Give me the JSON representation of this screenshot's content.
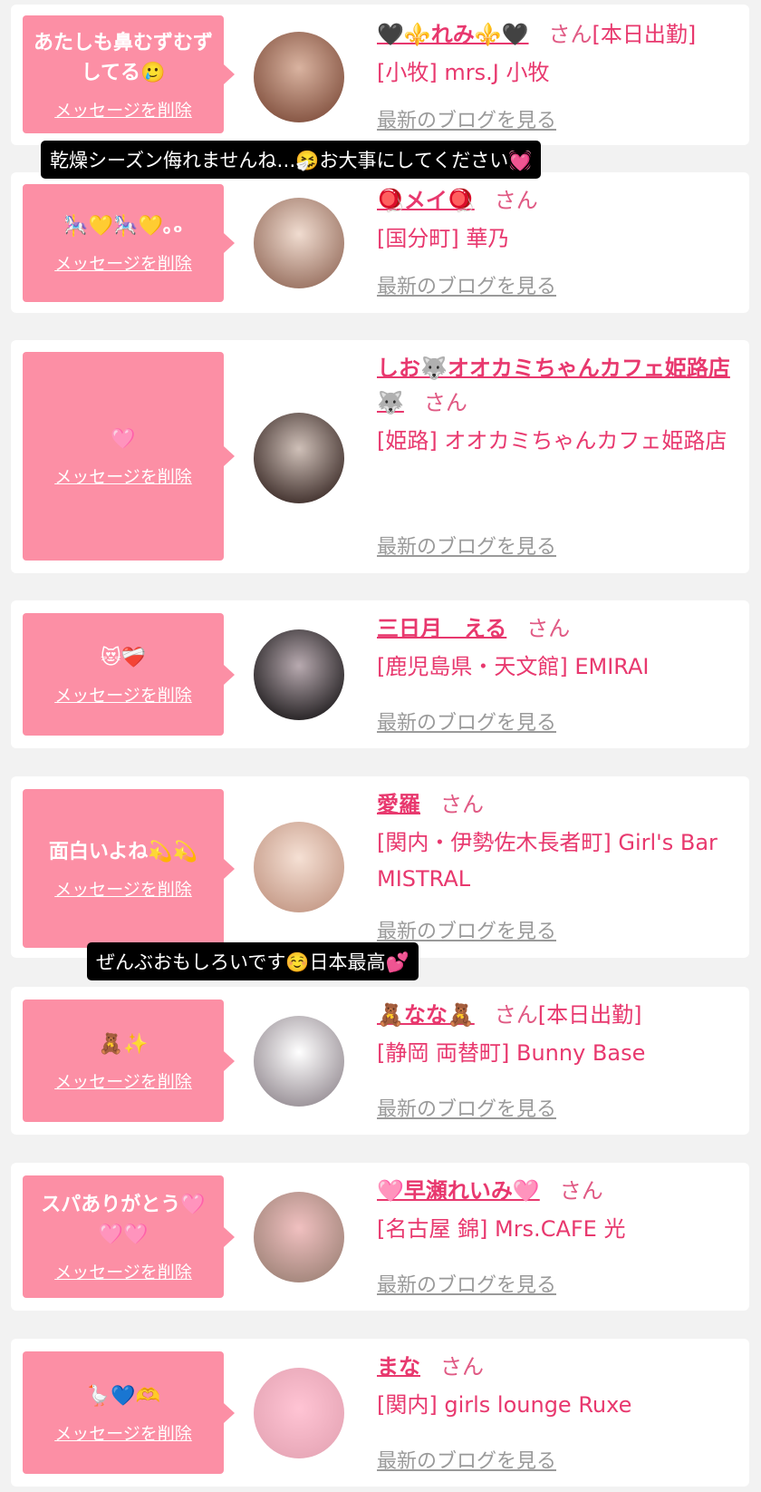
{
  "common": {
    "delete_label": "メッセージを削除",
    "blog_label": "最新のブログを見る",
    "san": "さん"
  },
  "toasts": [
    "乾燥シーズン侮れませんね…🤧お大事にしてください💓",
    "ぜんぶおもしろいです☺️日本最高💕"
  ],
  "entries": [
    {
      "message": "あたしも鼻むずむずしてる🥲",
      "name": "🖤⚜️れみ⚜️🖤",
      "status": "[本日出勤]",
      "shop": "[小牧] mrs.J 小牧"
    },
    {
      "message": "🎠💛🎠💛｡ₒ",
      "name": "🪀メイ🪀",
      "status": "",
      "shop": "[国分町] 華乃"
    },
    {
      "message": "🩷",
      "name": "しお🐺オオカミちゃんカフェ姫路店🐺",
      "status": "",
      "shop": "[姫路] オオカミちゃんカフェ姫路店"
    },
    {
      "message": "😻❤️‍🩹",
      "name": "三日月　える",
      "status": "",
      "shop": "[鹿児島県・天文館] EMIRAI"
    },
    {
      "message": "面白いよね💫💫",
      "name": "愛羅",
      "status": "",
      "shop": "[関内・伊勢佐木長者町] Girl's Bar MISTRAL"
    },
    {
      "message": "🧸✨",
      "name": "🧸なな🧸",
      "status": "[本日出勤]",
      "shop": "[静岡 両替町] Bunny Base"
    },
    {
      "message": "スパありがとう🩷🩷🩷",
      "name": "🩷早瀬れいみ🩷",
      "status": "",
      "shop": "[名古屋 錦] Mrs.CAFE 光"
    },
    {
      "message": "🪿💙🫶",
      "name": "まな",
      "status": "",
      "shop": "[関内] girls lounge Ruxe"
    }
  ],
  "avatar_colors": [
    "#8a5a48",
    "#c9a08e",
    "#4a3a36",
    "#2e2a2c",
    "#e6c3b0",
    "#d6d0d6",
    "#a88a80",
    "#f0b0c0"
  ]
}
